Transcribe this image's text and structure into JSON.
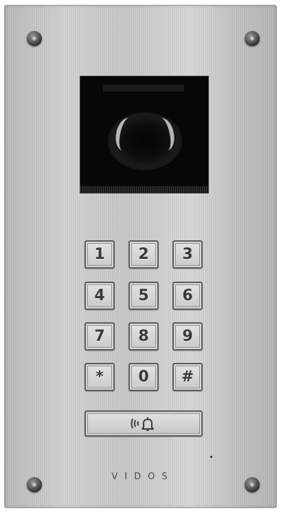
{
  "device": {
    "brand": "VIDOS",
    "keys": [
      "1",
      "2",
      "3",
      "4",
      "5",
      "6",
      "7",
      "8",
      "9",
      "*",
      "0",
      "#"
    ],
    "call_button_icon": "nfc-bell-icon"
  }
}
